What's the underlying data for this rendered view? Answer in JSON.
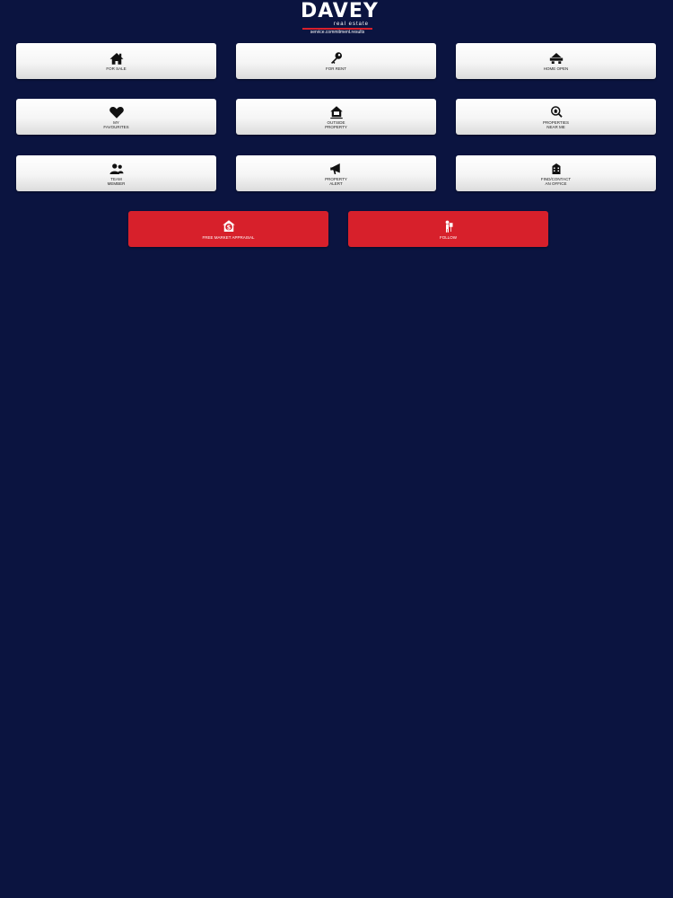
{
  "logo": {
    "word": "DAVEY",
    "sub": "real estate",
    "tagline": "service.commitment.results"
  },
  "tiles": [
    {
      "label": "For Sale",
      "icon": "house-icon"
    },
    {
      "label": "For Rent",
      "icon": "key-icon"
    },
    {
      "label": "Home Open",
      "icon": "open-house-icon"
    },
    {
      "label": "My\nFavourites",
      "icon": "heart-icon"
    },
    {
      "label": "Outside\nProperty",
      "icon": "home-outline-icon"
    },
    {
      "label": "Properties\nNear Me",
      "icon": "location-search-icon"
    },
    {
      "label": "Team\nMember",
      "icon": "people-icon"
    },
    {
      "label": "Property\nAlert",
      "icon": "megaphone-icon"
    },
    {
      "label": "Find/Contact\nAn Office",
      "icon": "office-icon"
    }
  ],
  "actions": [
    {
      "label": "Free Market Appraisal",
      "icon": "money-house-icon"
    },
    {
      "label": "Follow",
      "icon": "person-sign-icon"
    }
  ],
  "colors": {
    "background": "#0b1440",
    "accent_red": "#d7202b",
    "tile_white": "#f5f5f5"
  }
}
